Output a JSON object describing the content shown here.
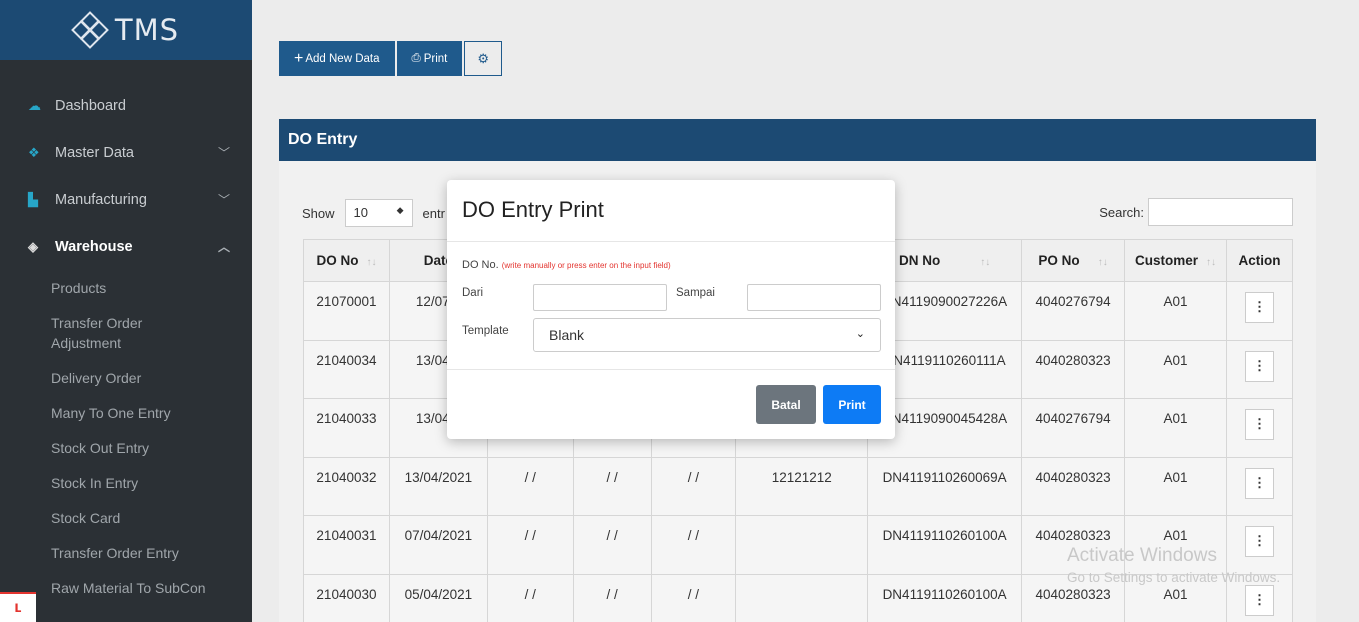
{
  "brand": {
    "name": "TMS"
  },
  "sidebar": {
    "items": [
      {
        "label": "Dashboard",
        "icon": "cloud-icon"
      },
      {
        "label": "Master Data",
        "icon": "cubes-icon"
      },
      {
        "label": "Manufacturing",
        "icon": "industry-icon"
      },
      {
        "label": "Warehouse",
        "icon": "box-icon"
      }
    ],
    "warehouse_sub": [
      "Products",
      "Transfer Order Adjustment",
      "Delivery Order",
      "Many To One Entry",
      "Stock Out Entry",
      "Stock In Entry",
      "Stock Card",
      "Transfer Order Entry",
      "Raw Material To SubCon"
    ]
  },
  "toolbar": {
    "add_label": "Add New Data",
    "print_label": "Print"
  },
  "panel": {
    "title": "DO Entry"
  },
  "table_controls": {
    "show_label": "Show",
    "show_value": "10",
    "entries_label": "entr",
    "search_label": "Search:"
  },
  "table": {
    "headers": [
      "DO No",
      "Date",
      "",
      "",
      "",
      "",
      "DN No",
      "PO No",
      "Customer",
      "Action"
    ],
    "rows": [
      [
        "21070001",
        "12/07/2",
        "",
        "",
        "",
        "",
        "DN4119090027226A",
        "4040276794",
        "A01"
      ],
      [
        "21040034",
        "13/04/2",
        "",
        "",
        "",
        "",
        "DN4119110260111A",
        "4040280323",
        "A01"
      ],
      [
        "21040033",
        "13/04/2",
        "",
        "",
        "",
        "",
        "DN4119090045428A",
        "4040276794",
        "A01"
      ],
      [
        "21040032",
        "13/04/2021",
        "/ /",
        "/ /",
        "/ /",
        "12121212",
        "DN4119110260069A",
        "4040280323",
        "A01"
      ],
      [
        "21040031",
        "07/04/2021",
        "/ /",
        "/ /",
        "/ /",
        "",
        "DN4119110260100A",
        "4040280323",
        "A01"
      ],
      [
        "21040030",
        "05/04/2021",
        "/ /",
        "/ /",
        "/ /",
        "",
        "DN4119110260100A",
        "4040280323",
        "A01"
      ]
    ]
  },
  "modal": {
    "title": "DO Entry Print",
    "do_label": "DO No.",
    "do_hint": "(write manually or press enter on the input field)",
    "dari_label": "Dari",
    "sampai_label": "Sampai",
    "template_label": "Template",
    "template_value": "Blank",
    "cancel_label": "Batal",
    "print_label": "Print"
  },
  "watermark": {
    "line1": "Activate Windows",
    "line2": "Go to Settings to activate Windows."
  }
}
